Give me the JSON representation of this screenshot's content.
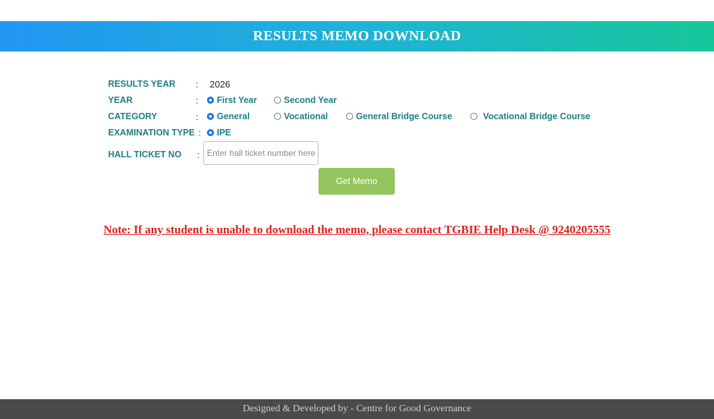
{
  "header": {
    "title": "RESULTS MEMO DOWNLOAD"
  },
  "form": {
    "results_year": {
      "label": "RESULTS YEAR",
      "colon": ":",
      "value": "2026"
    },
    "year": {
      "label": "YEAR",
      "colon": ":",
      "options": [
        {
          "label": "First Year",
          "checked": true
        },
        {
          "label": "Second Year",
          "checked": false
        }
      ]
    },
    "category": {
      "label": "CATEGORY",
      "colon": ":",
      "options": [
        {
          "label": "General",
          "checked": true
        },
        {
          "label": "Vocational",
          "checked": false
        },
        {
          "label": "General Bridge Course",
          "checked": false
        },
        {
          "label": "Vocational Bridge Course",
          "checked": false
        }
      ]
    },
    "examination_type": {
      "label": "EXAMINATION TYPE",
      "colon": ":",
      "options": [
        {
          "label": "IPE",
          "checked": true
        }
      ]
    },
    "hall_ticket": {
      "label": "HALL TICKET NO",
      "colon": ":",
      "value": "",
      "placeholder": "Enter hall ticket number here"
    },
    "submit_label": "Get Memo"
  },
  "note": "Note: If any student is unable to download the memo, please contact TGBIE Help Desk @ 9240205555",
  "footer": {
    "text": "Designed & Developed by - Centre for Good Governance"
  },
  "colors": {
    "header_gradient_start": "#2196f3",
    "header_gradient_end": "#17c79a",
    "label_teal": "#1e7f86",
    "button_green": "#94c45c",
    "note_red": "#e02020",
    "footer_bg": "#4a4a4a"
  }
}
